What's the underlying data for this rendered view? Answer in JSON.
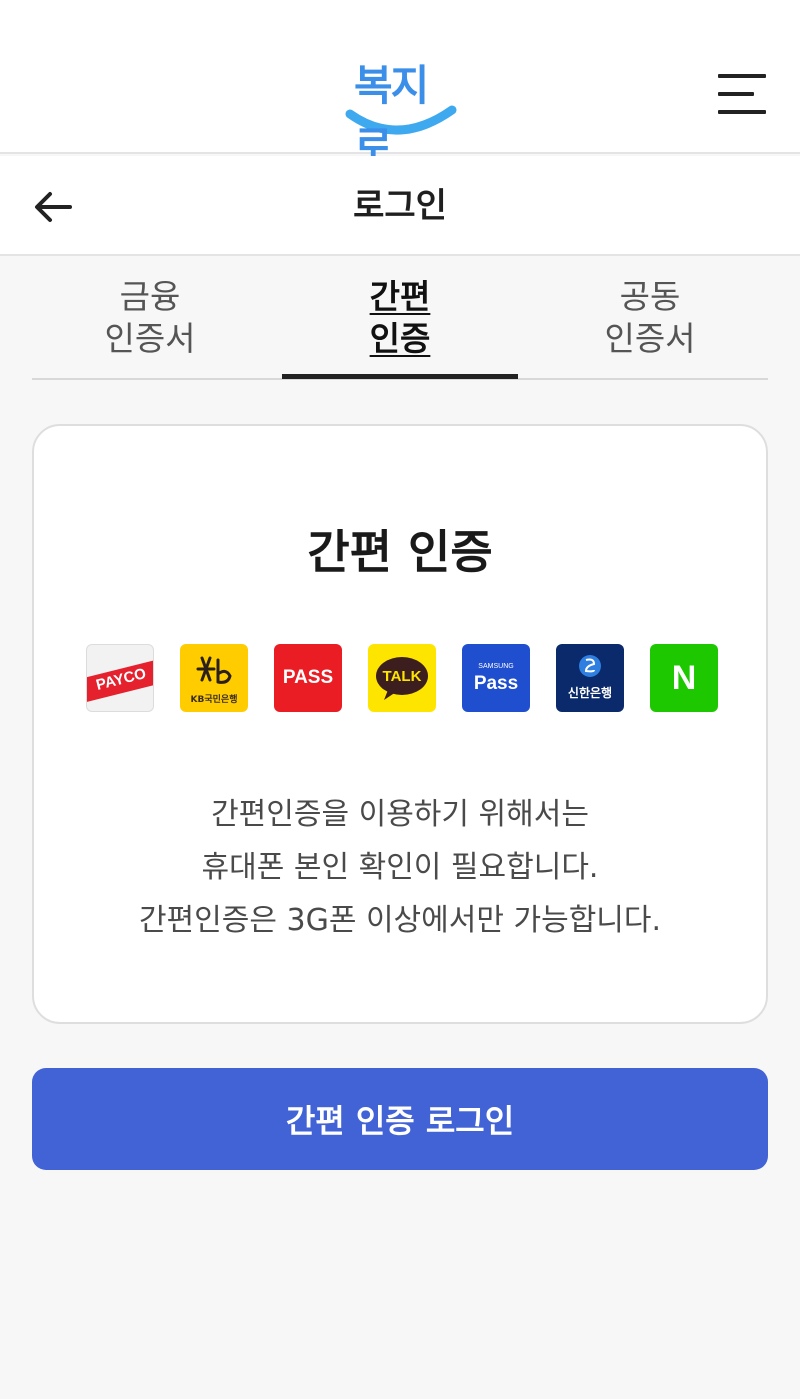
{
  "header": {
    "logo_text": "복지로",
    "menu_icon": "hamburger-menu-icon"
  },
  "subheader": {
    "back_icon": "arrow-left-icon",
    "title": "로그인"
  },
  "tabs": [
    {
      "line1": "금융",
      "line2": "인증서",
      "active": false
    },
    {
      "line1": "간편",
      "line2": "인증",
      "active": true
    },
    {
      "line1": "공동",
      "line2": "인증서",
      "active": false
    }
  ],
  "card": {
    "title": "간편 인증",
    "providers": [
      {
        "name": "PAYCO",
        "label": "PAYCO",
        "bg": "#f3f3f3",
        "fg": "#ffffff",
        "accent": "#e5212e"
      },
      {
        "name": "KB국민은행",
        "label": "KB국민은행",
        "bg": "#ffcc00",
        "fg": "#5a4a3a"
      },
      {
        "name": "PASS",
        "label": "PASS",
        "bg": "#ea1c24",
        "fg": "#ffffff"
      },
      {
        "name": "TALK",
        "label": "TALK",
        "bg": "#fee500",
        "fg": "#3c1e1e"
      },
      {
        "name": "SAMSUNG Pass",
        "label": "Pass",
        "sublabel": "SAMSUNG",
        "bg": "#1f4fcf",
        "fg": "#ffffff"
      },
      {
        "name": "신한은행",
        "label": "신한은행",
        "bg": "#0a2a6b",
        "fg": "#ffffff"
      },
      {
        "name": "N",
        "label": "N",
        "bg": "#1ec800",
        "fg": "#ffffff"
      }
    ],
    "description": [
      "간편인증을 이용하기 위해서는",
      "휴대폰 본인 확인이 필요합니다.",
      "간편인증은 3G폰 이상에서만 가능합니다."
    ]
  },
  "login_button": {
    "label": "간편 인증 로그인",
    "color": "#4263d6"
  }
}
